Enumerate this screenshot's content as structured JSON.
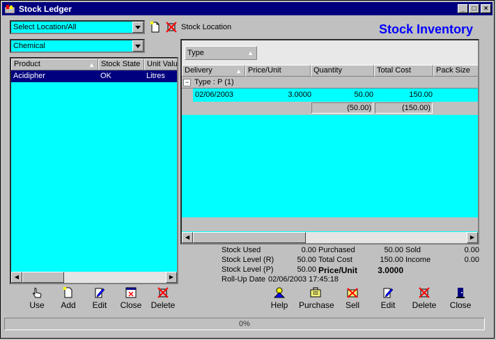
{
  "window": {
    "title": "Stock Ledger"
  },
  "left": {
    "location_combo": "Select Location/All",
    "category_combo": "Chemical",
    "stock_location_label": "Stock Location",
    "columns": [
      "Product",
      "Stock State",
      "Unit Value"
    ],
    "rows": [
      {
        "product": "Acidipher",
        "state": "OK",
        "unit": "Litres"
      }
    ]
  },
  "right": {
    "heading": "Stock Inventory",
    "group_field": "Type",
    "columns": [
      "Delivery",
      "Price/Unit",
      "Quantity",
      "Total Cost",
      "Pack Size"
    ],
    "group_label": "Type : P  (1)",
    "rows": [
      {
        "delivery": "02/06/2003",
        "price": "3.0000",
        "quantity": "50.00",
        "total": "150.00"
      }
    ],
    "subtotals": {
      "quantity": "(50.00)",
      "total": "(150.00)"
    }
  },
  "stats": {
    "stock_used_label": "Stock Used",
    "stock_used": "0.00",
    "purchased_label": "Purchased",
    "purchased": "50.00",
    "sold_label": "Sold",
    "sold": "0.00",
    "level_r_label": "Stock Level (R)",
    "level_r": "50.00",
    "total_cost_label": "Total Cost",
    "total_cost": "150.00",
    "income_label": "Income",
    "income": "0.00",
    "level_p_label": "Stock Level (P)",
    "level_p": "50.00",
    "price_unit_label": "Price/Unit",
    "price_unit": "3.0000",
    "rollup_label": "Roll-Up Date",
    "rollup": "02/06/2003 17:45:18"
  },
  "left_toolbar": [
    "Use",
    "Add",
    "Edit",
    "Close",
    "Delete"
  ],
  "right_toolbar": [
    "Help",
    "Purchase",
    "Sell",
    "Edit",
    "Delete",
    "Close"
  ],
  "status": {
    "progress_text": "0%",
    "progress": 0
  },
  "colors": {
    "grid_bg": "#00ffff",
    "selection": "#00007f",
    "heading": "#0000ff"
  }
}
